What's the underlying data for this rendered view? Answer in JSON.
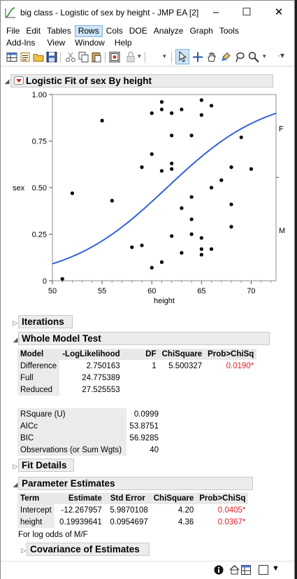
{
  "window": {
    "title": "big class - Logistic of sex by height - JMP EA [2]",
    "minimize": "–",
    "maximize": "☐",
    "close": "✕"
  },
  "menu": {
    "row1": [
      "File",
      "Edit",
      "Tables",
      "Rows",
      "Cols",
      "DOE",
      "Analyze",
      "Graph",
      "Tools"
    ],
    "row2": [
      "Add-Ins",
      "View",
      "Window",
      "Help"
    ],
    "active": "Rows"
  },
  "toolbar_icons": [
    "new-table-icon",
    "new-script-icon",
    "open-icon",
    "save-icon",
    "cut-icon",
    "copy-icon",
    "paste-icon",
    "journal-icon",
    "lock-icon",
    "arrow-tool-icon",
    "crosshair-tool-icon",
    "hand-tool-icon",
    "brush-tool-icon",
    "lasso-tool-icon",
    "magnifier-tool-icon"
  ],
  "report": {
    "title": "Logistic Fit of sex By height"
  },
  "chart_data": {
    "type": "scatter",
    "xlabel": "height",
    "ylabel": "sex",
    "xlim": [
      50,
      72.5
    ],
    "ylim": [
      0,
      1
    ],
    "xticks": [
      "50",
      "55",
      "60",
      "65",
      "70"
    ],
    "yticks": [
      "0",
      "0.25",
      "0.50",
      "0.75",
      "1.00"
    ],
    "right_labels": [
      "F",
      "M"
    ],
    "curve": {
      "intercept": -12.267957,
      "slope": 0.19939641,
      "color": "#2f63d6"
    },
    "points": [
      [
        51,
        0.01
      ],
      [
        52,
        0.47
      ],
      [
        55,
        0.86
      ],
      [
        56,
        0.43
      ],
      [
        58,
        0.18
      ],
      [
        59,
        0.19
      ],
      [
        59,
        0.61
      ],
      [
        60,
        0.9
      ],
      [
        60,
        0.68
      ],
      [
        60,
        0.07
      ],
      [
        61,
        0.96
      ],
      [
        61,
        0.92
      ],
      [
        61,
        0.59
      ],
      [
        61,
        0.1
      ],
      [
        62,
        0.9
      ],
      [
        62,
        0.78
      ],
      [
        62,
        0.63
      ],
      [
        62,
        0.6
      ],
      [
        62,
        0.24
      ],
      [
        63,
        0.92
      ],
      [
        63,
        0.39
      ],
      [
        63,
        0.15
      ],
      [
        64,
        0.78
      ],
      [
        64,
        0.45
      ],
      [
        64,
        0.33
      ],
      [
        64,
        0.25
      ],
      [
        65,
        0.97
      ],
      [
        65,
        0.89
      ],
      [
        65,
        0.23
      ],
      [
        65,
        0.17
      ],
      [
        65,
        0.14
      ],
      [
        66,
        0.94
      ],
      [
        66,
        0.5
      ],
      [
        66,
        0.17
      ],
      [
        67,
        0.54
      ],
      [
        68,
        0.61
      ],
      [
        68,
        0.41
      ],
      [
        68,
        0.29
      ],
      [
        69,
        0.77
      ],
      [
        70,
        0.6
      ]
    ]
  },
  "iterations": {
    "title": "Iterations"
  },
  "whole_model": {
    "title": "Whole Model Test",
    "headers": [
      "Model",
      "-LogLikelihood",
      "DF",
      "ChiSquare",
      "Prob>ChiSq"
    ],
    "rows": [
      {
        "model": "Difference",
        "loglik": "2.750163",
        "df": "1",
        "chisq": "5.500327",
        "prob": "0.0190*"
      },
      {
        "model": "Full",
        "loglik": "24.775389",
        "df": "",
        "chisq": "",
        "prob": ""
      },
      {
        "model": "Reduced",
        "loglik": "27.525553",
        "df": "",
        "chisq": "",
        "prob": ""
      }
    ],
    "stats": [
      {
        "label": "RSquare (U)",
        "value": "0.0999"
      },
      {
        "label": "AICc",
        "value": "53.8751"
      },
      {
        "label": "BIC",
        "value": "56.9285"
      },
      {
        "label": "Observations (or Sum Wgts)",
        "value": "40"
      }
    ]
  },
  "fit_details": {
    "title": "Fit Details"
  },
  "parameters": {
    "title": "Parameter Estimates",
    "headers": [
      "Term",
      "Estimate",
      "Std Error",
      "ChiSquare",
      "Prob>ChiSq"
    ],
    "rows": [
      {
        "term": "Intercept",
        "estimate": "-12.267957",
        "stderr": "5.9870108",
        "chisq": "4.20",
        "prob": "0.0405*"
      },
      {
        "term": "height",
        "estimate": "0.19939641",
        "stderr": "0.0954697",
        "chisq": "4.36",
        "prob": "0.0367*"
      }
    ],
    "note": "For log odds of M/F"
  },
  "covariance": {
    "title": "Covariance of Estimates"
  },
  "statusbar": [
    "info-icon",
    "home-icon",
    "table-icon",
    "checkbox-icon",
    "dropdown-icon"
  ]
}
